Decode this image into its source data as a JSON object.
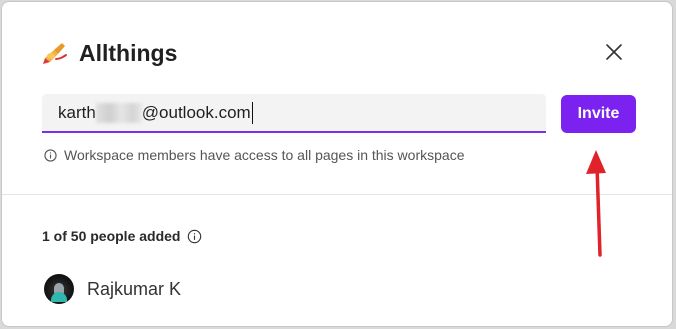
{
  "dialog": {
    "workspace_icon": "writing-hand-icon",
    "title": "Allthings",
    "close_icon": "close-icon"
  },
  "invite": {
    "email_prefix": "karth",
    "email_suffix": "@outlook.com",
    "button_label": "Invite",
    "accent_color": "#7b22f0"
  },
  "note": {
    "icon": "info-icon",
    "text": "Workspace members have access to all pages in this workspace"
  },
  "members": {
    "count_label": "1 of 50 people added",
    "count_icon": "info-icon",
    "list": [
      {
        "name": "Rajkumar K",
        "avatar": "avatar"
      }
    ]
  },
  "annotation": {
    "arrow_icon": "red-arrow-icon",
    "arrow_color": "#e0232b"
  }
}
